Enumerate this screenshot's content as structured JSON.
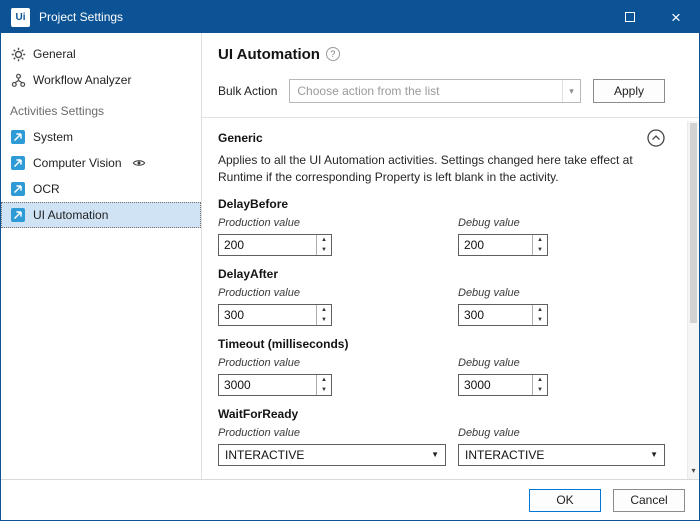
{
  "window": {
    "title": "Project Settings",
    "logo_text": "Ui"
  },
  "sidebar": {
    "items": [
      {
        "label": "General"
      },
      {
        "label": "Workflow Analyzer"
      }
    ],
    "section_header": "Activities Settings",
    "activities": [
      {
        "label": "System"
      },
      {
        "label": "Computer Vision"
      },
      {
        "label": "OCR"
      },
      {
        "label": "UI Automation"
      }
    ]
  },
  "main": {
    "title": "UI Automation",
    "bulk_action": {
      "label": "Bulk Action",
      "placeholder": "Choose action from the list",
      "apply_label": "Apply"
    },
    "generic": {
      "title": "Generic",
      "description": "Applies to all the UI Automation activities. Settings changed here take effect at Runtime if the corresponding Property is left blank in the activity.",
      "fields": [
        {
          "name": "DelayBefore",
          "production_label": "Production value",
          "debug_label": "Debug value",
          "production_value": "200",
          "debug_value": "200"
        },
        {
          "name": "DelayAfter",
          "production_label": "Production value",
          "debug_label": "Debug value",
          "production_value": "300",
          "debug_value": "300"
        },
        {
          "name": "Timeout (milliseconds)",
          "production_label": "Production value",
          "debug_label": "Debug value",
          "production_value": "3000",
          "debug_value": "3000"
        },
        {
          "name": "WaitForReady",
          "production_label": "Production value",
          "debug_label": "Debug value",
          "production_value": "INTERACTIVE",
          "debug_value": "INTERACTIVE"
        }
      ]
    }
  },
  "footer": {
    "ok_label": "OK",
    "cancel_label": "Cancel"
  },
  "colors": {
    "titlebar": "#0b5394",
    "accent_border": "#0078d7",
    "activity_icon_blue": "#2e9bd6",
    "selected_item_bg": "#cfe3f5"
  }
}
